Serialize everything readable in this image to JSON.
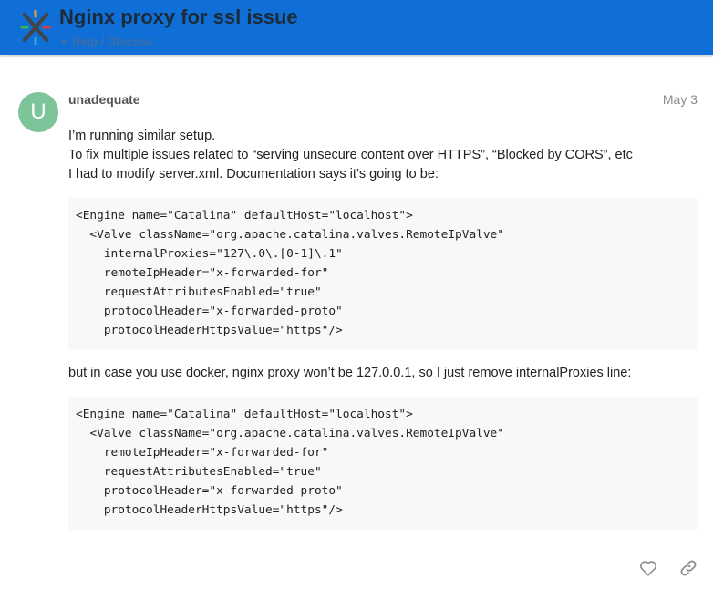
{
  "header": {
    "logo_icon": "x-logo-icon",
    "title": "Nginx proxy for ssl issue",
    "category": "Help / Discuss",
    "background_color": "#0f6fd6"
  },
  "post": {
    "avatar_letter": "U",
    "avatar_color": "#7dc49a",
    "username": "unadequate",
    "date": "May 3",
    "paragraph1": [
      "I’m running similar setup.",
      "To fix multiple issues related to “serving unsecure content over HTTPS”, “Blocked by CORS”, etc",
      "I had to modify server.xml. Documentation says it’s going to be:"
    ],
    "code1": [
      "<Engine name=\"Catalina\" defaultHost=\"localhost\">",
      "  <Valve className=\"org.apache.catalina.valves.RemoteIpValve\"",
      "    internalProxies=\"127\\.0\\.[0-1]\\.1\"",
      "    remoteIpHeader=\"x-forwarded-for\"",
      "    requestAttributesEnabled=\"true\"",
      "    protocolHeader=\"x-forwarded-proto\"",
      "    protocolHeaderHttpsValue=\"https\"/>"
    ],
    "paragraph2": "but in case you use docker, nginx proxy won’t be 127.0.0.1, so I just remove internalProxies line:",
    "code2": [
      "<Engine name=\"Catalina\" defaultHost=\"localhost\">",
      "  <Valve className=\"org.apache.catalina.valves.RemoteIpValve\"",
      "    remoteIpHeader=\"x-forwarded-for\"",
      "    requestAttributesEnabled=\"true\"",
      "    protocolHeader=\"x-forwarded-proto\"",
      "    protocolHeaderHttpsValue=\"https\"/>"
    ]
  },
  "actions": {
    "like_icon": "heart-icon",
    "share_icon": "link-icon"
  }
}
